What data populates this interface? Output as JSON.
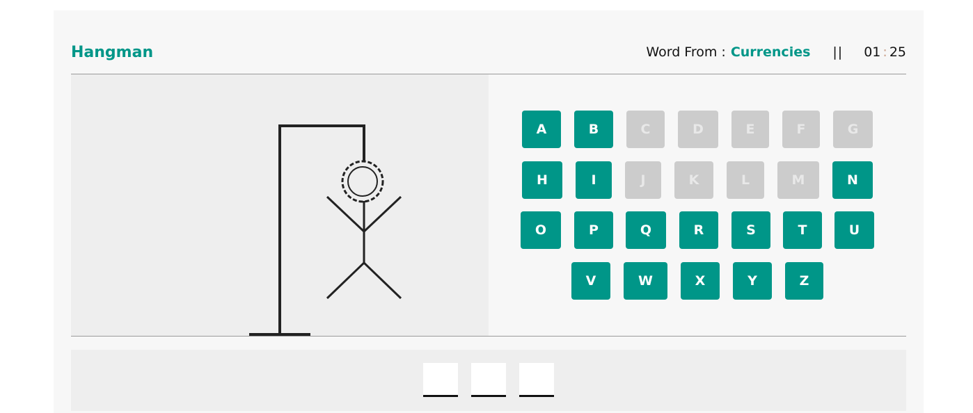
{
  "header": {
    "title": "Hangman",
    "word_from_label": "Word From :",
    "category": "Currencies",
    "pause_label": "||",
    "timer_minutes": "01",
    "timer_separator": ":",
    "timer_seconds": "25"
  },
  "keyboard": {
    "rows": [
      [
        {
          "letter": "A",
          "state": "active"
        },
        {
          "letter": "B",
          "state": "active"
        },
        {
          "letter": "C",
          "state": "used"
        },
        {
          "letter": "D",
          "state": "used"
        },
        {
          "letter": "E",
          "state": "used"
        },
        {
          "letter": "F",
          "state": "used"
        },
        {
          "letter": "G",
          "state": "used"
        }
      ],
      [
        {
          "letter": "H",
          "state": "active"
        },
        {
          "letter": "I",
          "state": "active"
        },
        {
          "letter": "J",
          "state": "used"
        },
        {
          "letter": "K",
          "state": "used"
        },
        {
          "letter": "L",
          "state": "used"
        },
        {
          "letter": "M",
          "state": "used"
        },
        {
          "letter": "N",
          "state": "active"
        }
      ],
      [
        {
          "letter": "O",
          "state": "active"
        },
        {
          "letter": "P",
          "state": "active"
        },
        {
          "letter": "Q",
          "state": "active"
        },
        {
          "letter": "R",
          "state": "active"
        },
        {
          "letter": "S",
          "state": "active"
        },
        {
          "letter": "T",
          "state": "active"
        },
        {
          "letter": "U",
          "state": "active"
        }
      ],
      [
        {
          "letter": "V",
          "state": "active"
        },
        {
          "letter": "W",
          "state": "active"
        },
        {
          "letter": "X",
          "state": "active"
        },
        {
          "letter": "Y",
          "state": "active"
        },
        {
          "letter": "Z",
          "state": "active"
        }
      ]
    ]
  },
  "word": {
    "slots": [
      "",
      "",
      ""
    ]
  },
  "colors": {
    "accent": "#009688",
    "used_key": "#cccccc",
    "figure": "#222222"
  }
}
